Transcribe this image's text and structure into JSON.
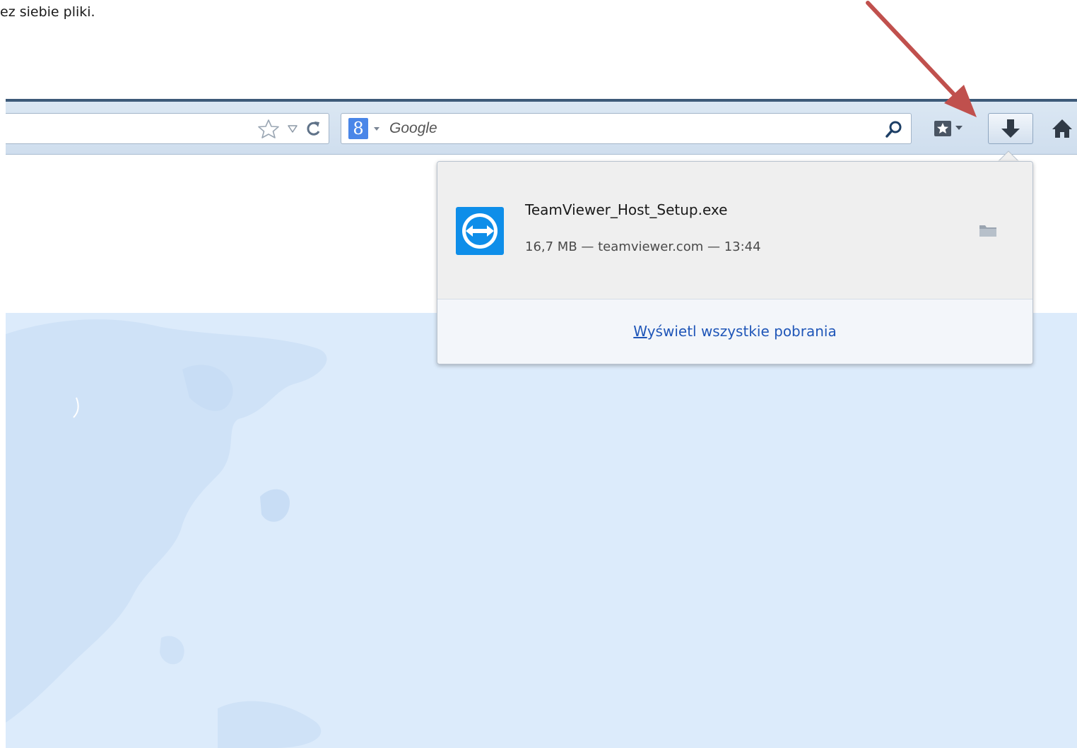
{
  "document": {
    "caption": "ez siebie pliki."
  },
  "toolbar": {
    "url_bar_icons": [
      "star-icon",
      "history-dropdown-icon",
      "reload-icon"
    ],
    "search": {
      "engine_icon": "google-icon",
      "engine_letter": "8",
      "placeholder": "Google"
    },
    "buttons": [
      "bookmarks-icon",
      "downloads-icon",
      "home-icon"
    ]
  },
  "downloads_panel": {
    "item": {
      "icon": "teamviewer-icon",
      "filename": "TeamViewer_Host_Setup.exe",
      "details": "16,7 MB — teamviewer.com — 13:44",
      "action_icon": "folder-icon"
    },
    "show_all": {
      "access_key": "W",
      "label_rest": "yświetl wszystkie pobrania"
    }
  },
  "colors": {
    "annotation_arrow": "#c0504d",
    "link": "#1f56b8",
    "teamviewer_blue": "#0e8ee9",
    "banner_background": "#dcebfb"
  }
}
